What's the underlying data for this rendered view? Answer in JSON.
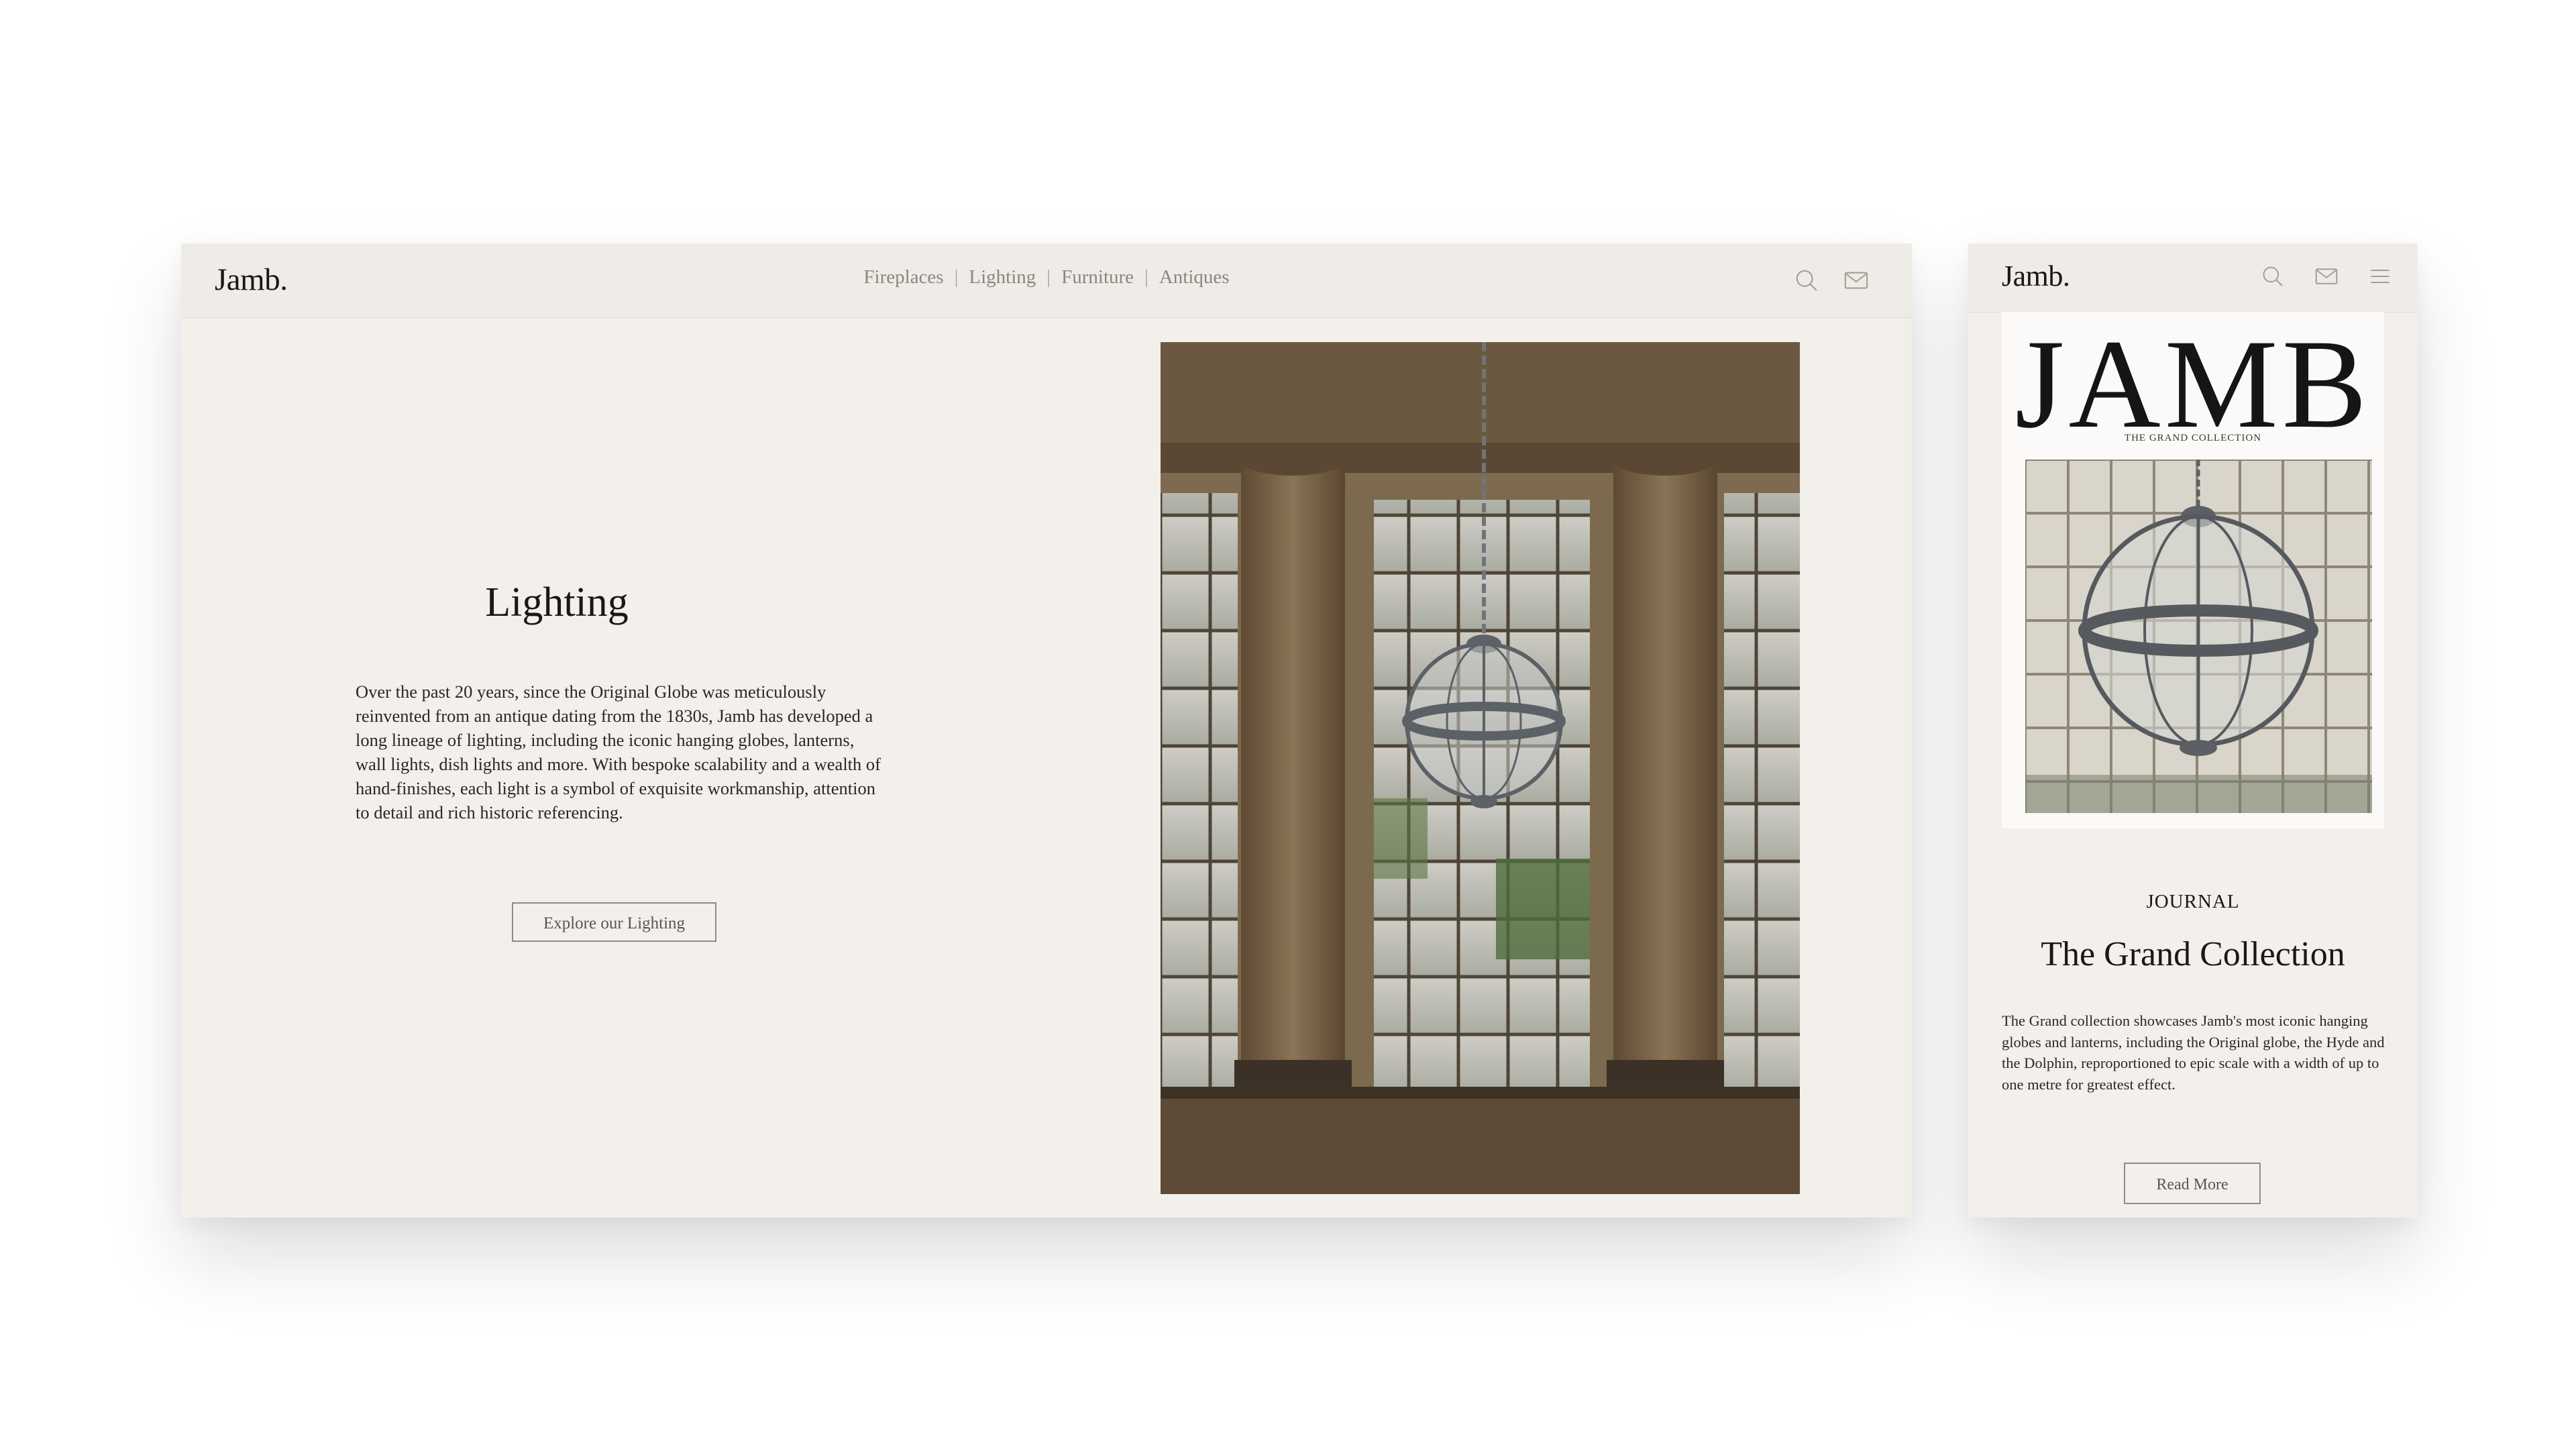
{
  "desktop": {
    "logo": "Jamb.",
    "nav": [
      {
        "label": "Fireplaces"
      },
      {
        "label": "Lighting"
      },
      {
        "label": "Furniture"
      },
      {
        "label": "Antiques"
      }
    ],
    "nav_separator": "|",
    "icons": [
      "search-icon",
      "mail-icon"
    ],
    "hero": {
      "title": "Lighting",
      "body": "Over the past 20 years, since the Original Globe was meticulously reinvented from an antique dating from the 1830s, Jamb has developed a long lineage of lighting, including the iconic hanging globes, lanterns, wall lights, dish lights and more. With bespoke scalability and a wealth of hand-finishes, each light is a symbol of exquisite workmanship, attention to detail and rich historic referencing.",
      "button": "Explore our Lighting"
    }
  },
  "mobile": {
    "logo": "Jamb.",
    "icons": [
      "search-icon",
      "mail-icon",
      "menu-icon"
    ],
    "cover": {
      "title": "JAMB",
      "subtitle": "THE GRAND COLLECTION"
    },
    "kicker": "JOURNAL",
    "title": "The Grand Collection",
    "body": "The Grand collection showcases Jamb's most iconic hanging globes and lanterns, including the Original globe, the Hyde and the Dolphin, reproportioned to epic scale with a width of up to one metre for greatest effect.",
    "button": "Read More"
  },
  "colors": {
    "page_bg": "#ffffff",
    "panel_bg": "#f3efeb",
    "header_bg": "#efece7",
    "text": "#1a1816",
    "muted": "#8b8680"
  }
}
